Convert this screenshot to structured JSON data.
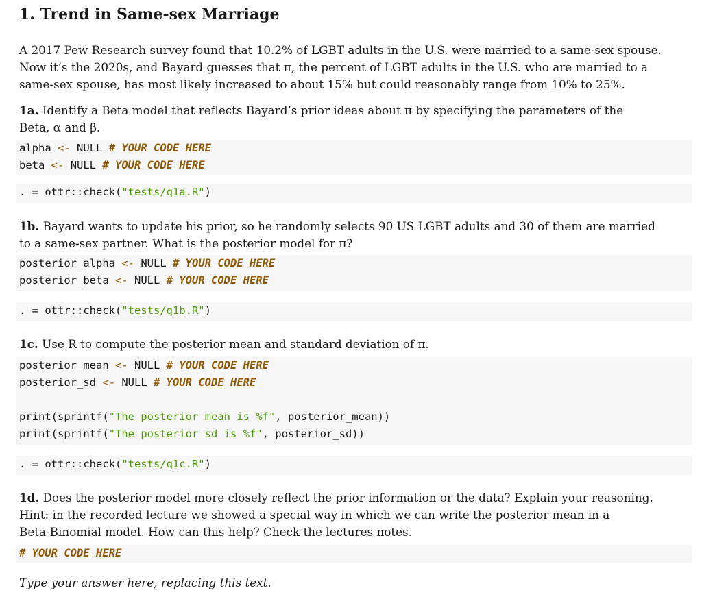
{
  "title": "1. Trend in Same-sex Marriage",
  "intro": [
    "A 2017 Pew Research survey found that 10.2% of LGBT adults in the U.S. were married to a same-sex spouse.",
    "Now it’s the 2020s, and Bayard guesses that π, the percent of LGBT adults in the U.S. who are married to a",
    "same-sex spouse, has most likely increased to about 15% but could reasonably range from 10% to 25%."
  ],
  "q1a": {
    "label": "1a.",
    "text_lines": [
      " Identify a Beta model that reflects Bayard’s prior ideas about π by specifying the parameters of the",
      "Beta, α and β."
    ],
    "code": [
      {
        "name": "alpha",
        "assign": "<-",
        "value": "NULL",
        "comment": "# YOUR CODE HERE"
      },
      {
        "name": "beta",
        "assign": "<-",
        "value": "NULL",
        "comment": "# YOUR CODE HERE"
      }
    ],
    "check": {
      "prefix": ". = ottr::check(",
      "arg": "\"tests/q1a.R\"",
      "suffix": ")"
    }
  },
  "q1b": {
    "label": "1b.",
    "text_lines": [
      " Bayard wants to update his prior, so he randomly selects 90 US LGBT adults and 30 of them are married",
      "to a same-sex partner. What is the posterior model for π?"
    ],
    "code": [
      {
        "name": "posterior_alpha",
        "assign": "<-",
        "value": "NULL",
        "comment": "# YOUR CODE HERE"
      },
      {
        "name": "posterior_beta",
        "assign": "<-",
        "value": "NULL",
        "comment": "# YOUR CODE HERE"
      }
    ],
    "check": {
      "prefix": ". = ottr::check(",
      "arg": "\"tests/q1b.R\"",
      "suffix": ")"
    }
  },
  "q1c": {
    "label": "1c.",
    "text_lines": [
      " Use R to compute the posterior mean and standard deviation of π."
    ],
    "code": [
      {
        "name": "posterior_mean",
        "assign": "<-",
        "value": "NULL",
        "comment": "# YOUR CODE HERE"
      },
      {
        "name": "posterior_sd",
        "assign": "<-",
        "value": "NULL",
        "comment": "# YOUR CODE HERE"
      }
    ],
    "prints": [
      {
        "fn": "print(sprintf(",
        "str": "\"The posterior mean is %f\"",
        "rest": ", posterior_mean))"
      },
      {
        "fn": "print(sprintf(",
        "str": "\"The posterior sd is %f\"",
        "rest": ", posterior_sd))"
      }
    ],
    "check": {
      "prefix": ". = ottr::check(",
      "arg": "\"tests/q1c.R\"",
      "suffix": ")"
    }
  },
  "q1d": {
    "label": "1d.",
    "text_lines": [
      " Does the posterior model more closely reflect the prior information or the data? Explain your reasoning.",
      "Hint: in the recorded lecture we showed a special way in which we can write the posterior mean in a",
      "Beta-Binomial model. How can this help? Check the lectures notes."
    ],
    "code_comment": "# YOUR CODE HERE",
    "answer": "Type your answer here, replacing this text."
  }
}
